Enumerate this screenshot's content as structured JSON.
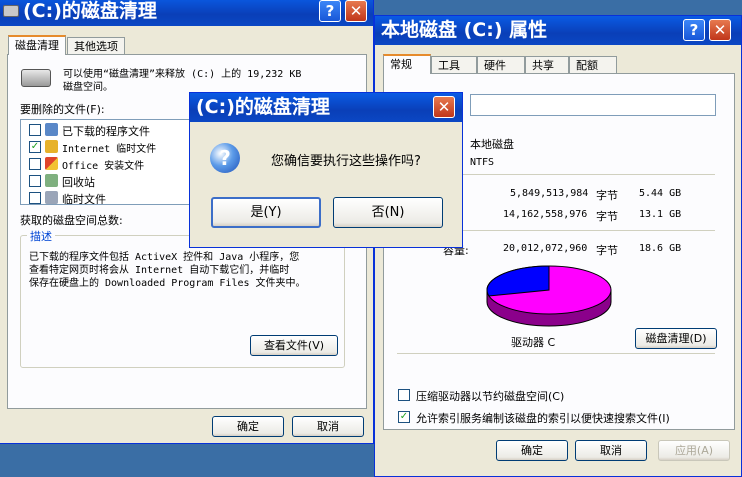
{
  "cleanup": {
    "title": "(C:)的磁盘清理",
    "tabs": [
      "磁盘清理",
      "其他选项"
    ],
    "intro_line1": "可以使用“磁盘清理”来释放 (C:) 上的 19,232 KB",
    "intro_line2": "磁盘空间。",
    "files_label": "要删除的文件(F):",
    "files": [
      {
        "label": "已下载的程序文件",
        "checked": false
      },
      {
        "label": "Internet 临时文件",
        "checked": true
      },
      {
        "label": "Office 安装文件",
        "checked": false
      },
      {
        "label": "回收站",
        "checked": false
      },
      {
        "label": "临时文件",
        "checked": false
      }
    ],
    "total_label": "获取的磁盘空间总数:",
    "desc_legend": "描述",
    "desc_line1": "已下载的程序文件包括 ActiveX 控件和 Java 小程序，您",
    "desc_line2": "查看特定网页时将会从 Internet 自动下载它们，并临时",
    "desc_line3": "保存在硬盘上的 Downloaded Program Files 文件夹中。",
    "view_files": "查看文件(V)",
    "ok": "确定",
    "cancel": "取消"
  },
  "props": {
    "title": "本地磁盘 (C:) 属性",
    "tabs": [
      "常规",
      "工具",
      "硬件",
      "共享",
      "配额"
    ],
    "name_value": "",
    "type_value": "本地磁盘",
    "fs_value": "NTFS",
    "used_bytes": "5,849,513,984",
    "used_unit": "字节",
    "used_gb": "5.44 GB",
    "free_bytes": "14,162,558,976",
    "free_unit": "字节",
    "free_gb": "13.1 GB",
    "cap_label": "容量:",
    "cap_bytes": "20,012,072,960",
    "cap_unit": "字节",
    "cap_gb": "18.6 GB",
    "drive_label": "驱动器 C",
    "cleanup_button": "磁盘清理(D)",
    "compress_label": "压缩驱动器以节约磁盘空间(C)",
    "compress_checked": false,
    "index_label": "允许索引服务编制该磁盘的索引以便快速搜索文件(I)",
    "index_checked": true,
    "ok": "确定",
    "cancel": "取消",
    "apply": "应用(A)",
    "used_fraction": 0.29,
    "colors": {
      "used": "#0000ff",
      "free": "#ff00ff"
    }
  },
  "confirm": {
    "title": "(C:)的磁盘清理",
    "message": "您确信要执行这些操作吗?",
    "yes": "是(Y)",
    "no": "否(N)"
  }
}
